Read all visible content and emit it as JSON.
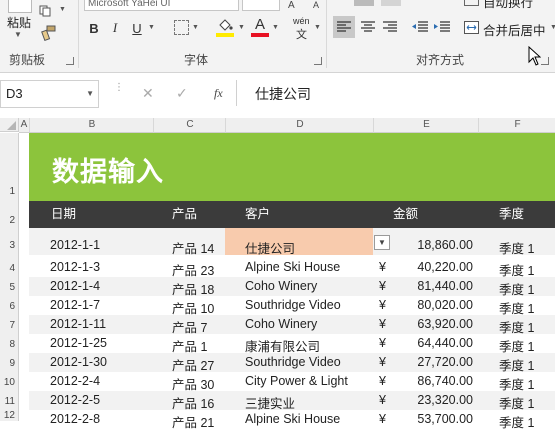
{
  "ribbon": {
    "font_name": "Microsoft YaHei UI",
    "paste_label": "粘贴",
    "clipboard_label": "剪贴板",
    "font_label": "字体",
    "alignment_label": "对齐方式",
    "merge_center_label": "合并后居中",
    "wrap_text_label": "自动换行",
    "bold": "B",
    "italic": "I",
    "underline": "U",
    "font_color_glyph": "A",
    "phonetic_glyph": "wén",
    "font_color_bar": "#e81123",
    "fill_color_bar": "#ffeb00"
  },
  "formula_bar": {
    "name_box": "D3",
    "fx": "fx",
    "cancel": "✕",
    "enter": "✓",
    "value": "仕捷公司"
  },
  "columns": [
    "A",
    "B",
    "C",
    "D",
    "E",
    "F"
  ],
  "rows": [
    "1",
    "2",
    "3",
    "4",
    "5",
    "6",
    "7",
    "8",
    "9",
    "10",
    "11",
    "12"
  ],
  "sheet": {
    "title": "数据输入",
    "title_color": "#8cc43c",
    "headers": [
      "日期",
      "产品",
      "客户",
      "金额",
      "季度"
    ],
    "selected_fill": "#f8cbad",
    "rows": [
      {
        "date": "2012-1-1",
        "product": "产品 14",
        "customer": "仕捷公司",
        "currency": "",
        "amount": "18,860.00",
        "quarter": "季度 1"
      },
      {
        "date": "2012-1-3",
        "product": "产品 23",
        "customer": "Alpine Ski House",
        "currency": "¥",
        "amount": "40,220.00",
        "quarter": "季度 1"
      },
      {
        "date": "2012-1-4",
        "product": "产品 18",
        "customer": "Coho Winery",
        "currency": "¥",
        "amount": "81,440.00",
        "quarter": "季度 1"
      },
      {
        "date": "2012-1-7",
        "product": "产品 10",
        "customer": "Southridge Video",
        "currency": "¥",
        "amount": "80,020.00",
        "quarter": "季度 1"
      },
      {
        "date": "2012-1-11",
        "product": "产品 7",
        "customer": "Coho Winery",
        "currency": "¥",
        "amount": "63,920.00",
        "quarter": "季度 1"
      },
      {
        "date": "2012-1-25",
        "product": "产品 1",
        "customer": "康浦有限公司",
        "currency": "¥",
        "amount": "64,440.00",
        "quarter": "季度 1"
      },
      {
        "date": "2012-1-30",
        "product": "产品 27",
        "customer": "Southridge Video",
        "currency": "¥",
        "amount": "27,720.00",
        "quarter": "季度 1"
      },
      {
        "date": "2012-2-4",
        "product": "产品 30",
        "customer": "City Power & Light",
        "currency": "¥",
        "amount": "86,740.00",
        "quarter": "季度 1"
      },
      {
        "date": "2012-2-5",
        "product": "产品 16",
        "customer": "三捷实业",
        "currency": "¥",
        "amount": "23,320.00",
        "quarter": "季度 1"
      },
      {
        "date": "2012-2-8",
        "product": "产品 21",
        "customer": "Alpine Ski House",
        "currency": "¥",
        "amount": "53,700.00",
        "quarter": "季度 1"
      }
    ]
  }
}
